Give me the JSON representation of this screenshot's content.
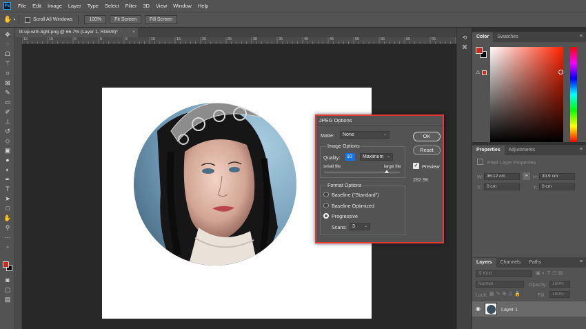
{
  "menu": [
    "File",
    "Edit",
    "Image",
    "Layer",
    "Type",
    "Select",
    "Filter",
    "3D",
    "View",
    "Window",
    "Help"
  ],
  "app_logo": "Ps",
  "options_bar": {
    "scroll_all_label": "Scroll All Windows",
    "zoom_value": "100%",
    "fit_screen": "Fit Screen",
    "fill_screen": "Fill Screen"
  },
  "doc_tab": {
    "title": "lit-up-with-light.png @ 66.7% (Layer 1, RGB/8)",
    "modified_marker": "*",
    "close": "×"
  },
  "ruler_marks": [
    "15",
    "10",
    "5",
    "0",
    "5",
    "10",
    "15",
    "20",
    "25",
    "30",
    "35",
    "40",
    "45",
    "50",
    "55",
    "60",
    "65"
  ],
  "jpeg_dialog": {
    "title": "JPEG Options",
    "matte_label": "Matte:",
    "matte_value": "None",
    "image_options_label": "Image Options",
    "quality_label": "Quality:",
    "quality_value": "10",
    "quality_preset": "Maximum",
    "small_file": "small file",
    "large_file": "large file",
    "quality_fraction": 0.83,
    "format_options_label": "Format Options",
    "format_baseline_standard": "Baseline (\"Standard\")",
    "format_baseline_optimized": "Baseline Optimized",
    "format_progressive": "Progressive",
    "scans_label": "Scans:",
    "scans_value": "3",
    "ok": "OK",
    "reset": "Reset",
    "preview_label": "Preview",
    "file_size": "282.9K"
  },
  "color_panel": {
    "tabs": [
      "Color",
      "Swatches"
    ],
    "foreground_color": "#cc2a1a",
    "background_color": "#000000",
    "hue_base": "#ff2200"
  },
  "properties_panel": {
    "tabs": [
      "Properties",
      "Adjustments"
    ],
    "subtitle": "Pixel Layer Properties",
    "w_label": "W:",
    "w_value": "36.12 cm",
    "h_label": "H:",
    "h_value": "30.9 cm",
    "x_label": "X:",
    "x_value": "0 cm",
    "y_label": "Y:",
    "y_value": "0 cm"
  },
  "layers_panel": {
    "tabs": [
      "Layers",
      "Channels",
      "Paths"
    ],
    "filter_kind": "Kind",
    "blend_mode": "Normal",
    "opacity_label": "Opacity:",
    "opacity_value": "100%",
    "lock_label": "Lock:",
    "fill_label": "Fill:",
    "fill_value": "100%",
    "layer_name": "Layer 1"
  }
}
